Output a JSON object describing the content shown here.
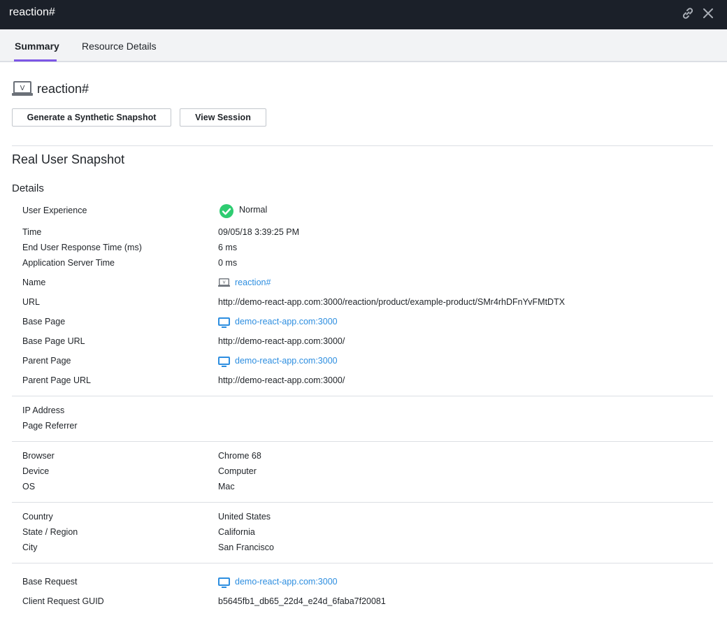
{
  "window": {
    "title": "reaction#",
    "link_icon": "link-icon",
    "close_icon": "close-icon"
  },
  "tabs": [
    {
      "label": "Summary",
      "active": true
    },
    {
      "label": "Resource Details",
      "active": false
    }
  ],
  "header": {
    "page_icon": "monitor-v-icon",
    "title": "reaction#",
    "buttons": {
      "synthetic": "Generate a Synthetic Snapshot",
      "session": "View Session"
    }
  },
  "section_title": "Real User Snapshot",
  "details_title": "Details",
  "details": {
    "user_experience": {
      "label": "User Experience",
      "value": "Normal",
      "status_color": "#2ecc71"
    },
    "time": {
      "label": "Time",
      "value": "09/05/18 3:39:25 PM"
    },
    "response_time": {
      "label": "End User Response Time (ms)",
      "value": "6 ms"
    },
    "server_time": {
      "label": "Application Server Time",
      "value": "0 ms"
    },
    "name": {
      "label": "Name",
      "value": "reaction#",
      "icon": "monitor-v-icon"
    },
    "url": {
      "label": "URL",
      "value": "http://demo-react-app.com:3000/reaction/product/example-product/SMr4rhDFnYvFMtDTX"
    },
    "base_page": {
      "label": "Base Page",
      "value": "demo-react-app.com:3000",
      "icon": "screen-icon"
    },
    "base_page_url": {
      "label": "Base Page URL",
      "value": "http://demo-react-app.com:3000/"
    },
    "parent_page": {
      "label": "Parent Page",
      "value": "demo-react-app.com:3000",
      "icon": "screen-icon"
    },
    "parent_page_url": {
      "label": "Parent Page URL",
      "value": "http://demo-react-app.com:3000/"
    },
    "ip_address": {
      "label": "IP Address",
      "value": ""
    },
    "page_referrer": {
      "label": "Page Referrer",
      "value": ""
    },
    "browser": {
      "label": "Browser",
      "value": "Chrome 68"
    },
    "device": {
      "label": "Device",
      "value": "Computer"
    },
    "os": {
      "label": "OS",
      "value": "Mac"
    },
    "country": {
      "label": "Country",
      "value": "United States"
    },
    "region": {
      "label": "State / Region",
      "value": "California"
    },
    "city": {
      "label": "City",
      "value": "San Francisco"
    },
    "base_request": {
      "label": "Base Request",
      "value": "demo-react-app.com:3000",
      "icon": "screen-icon"
    },
    "client_guid": {
      "label": "Client Request GUID",
      "value": "b5645fb1_db65_22d4_e24d_6faba7f20081"
    }
  },
  "colors": {
    "titlebar": "#1b2029",
    "accent": "#7d57e6",
    "link": "#2d8ee0",
    "success": "#2ecc71"
  }
}
